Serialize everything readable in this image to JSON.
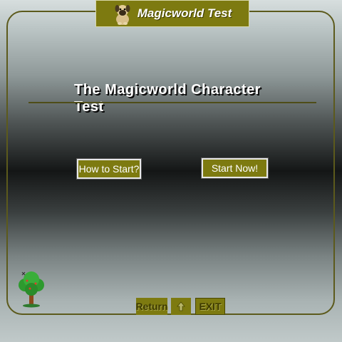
{
  "banner": {
    "title": "Magicworld Test",
    "icon": "dog-icon"
  },
  "main": {
    "headline": "The Magicworld Character Test"
  },
  "buttons": {
    "how_to_start": "How to Start?",
    "start_now": "Start Now!"
  },
  "nav": {
    "return_label": "Return",
    "up_icon": "up-arrow-icon",
    "exit_label": "EXIT"
  },
  "decor": {
    "tree_icon": "tree-icon"
  },
  "colors": {
    "accent": "#7d7a10",
    "frame": "#5c5a1c",
    "text": "#ffffff"
  }
}
